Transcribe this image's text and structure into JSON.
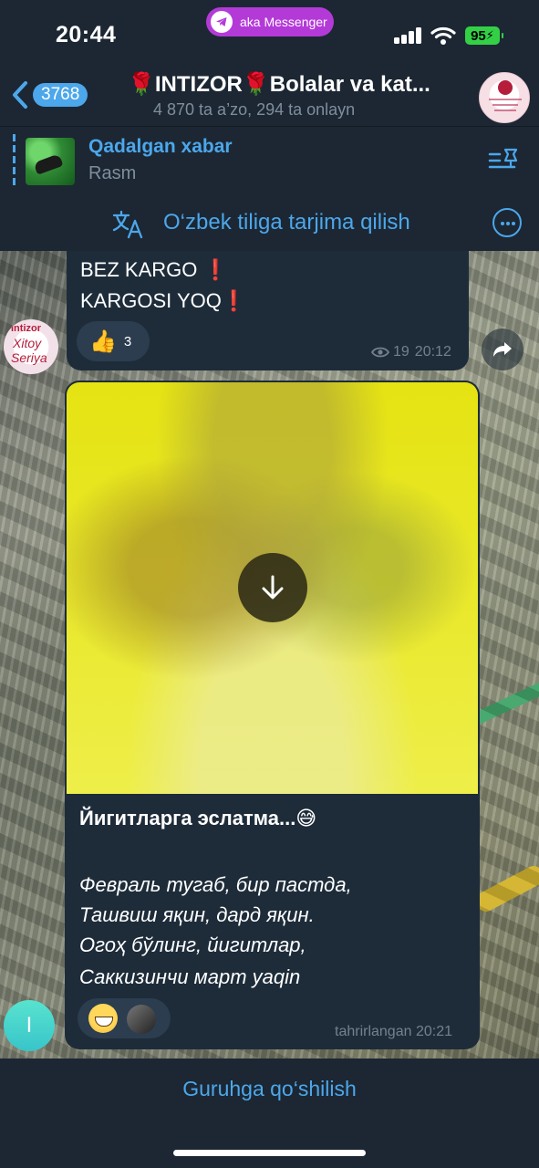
{
  "status_bar": {
    "time": "20:44",
    "pill_label": "aka Messenger",
    "battery": "95"
  },
  "header": {
    "unread_badge": "3768",
    "title": "🌹INTIZOR🌹Bolalar va kat...",
    "subtitle": "4 870 ta a’zo, 294 ta onlayn"
  },
  "pinned": {
    "title": "Qadalgan xabar",
    "subtitle": "Rasm"
  },
  "translate": {
    "label": "O‘zbek tiligа tarjima qilish"
  },
  "messages": [
    {
      "lines": [
        "BEZ KARGO",
        "KARGOSI YOQ"
      ],
      "reaction_emoji": "👍",
      "reaction_count": "3",
      "views": "19",
      "time": "20:12",
      "sender_avatar_text": [
        "Intizor",
        "Xitoy",
        "Seriya"
      ]
    },
    {
      "caption_title": "Йигитларга эслатма...😅",
      "caption_lines": [
        "Февраль тугаб, бир пастда,",
        "Ташвиш яқин, дард яқин.",
        "Огоҳ бўлинг, йигитлар,",
        "Саккизинчи март yaqin"
      ],
      "edited_time": "tahrirlangan 20:21"
    }
  ],
  "left_avatar_letter": "I",
  "bottom": {
    "join_label": "Guruhga qo‘shilish"
  },
  "colors": {
    "accent": "#4ca7eb",
    "background": "#1c2733",
    "bubble": "#1e2c3a",
    "alert_red": "#e0262e"
  },
  "icons": [
    "back-chevron-icon",
    "telegram-icon",
    "pin-list-icon",
    "translate-icon",
    "more-icon",
    "eye-icon",
    "share-icon",
    "download-icon"
  ]
}
